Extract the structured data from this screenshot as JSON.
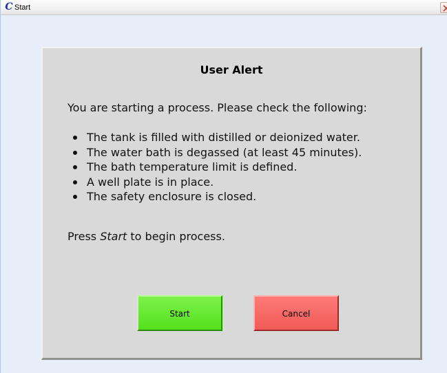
{
  "window": {
    "title": "Start",
    "app_icon_glyph": "C",
    "icon": "app-logo-icon",
    "close_icon": "close-icon"
  },
  "alert": {
    "title": "User Alert",
    "intro": "You are starting a process. Please check the following:",
    "items": [
      "The tank is filled with distilled or deionized water.",
      "The water bath is degassed (at least 45 minutes).",
      "The bath temperature limit is defined.",
      "A well plate is in place.",
      "The safety enclosure is closed."
    ],
    "press_prefix": "Press ",
    "press_emphasis": "Start",
    "press_suffix": " to begin process."
  },
  "buttons": {
    "start_label": "Start",
    "cancel_label": "Cancel"
  },
  "colors": {
    "start_button": "#66e82f",
    "cancel_button": "#f56663",
    "panel": "#d9d9d9",
    "window_background": "#e7eefa"
  }
}
